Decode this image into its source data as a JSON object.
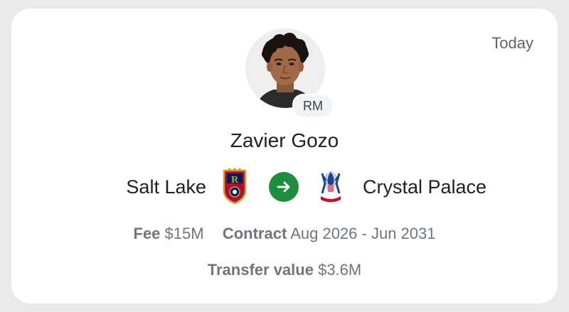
{
  "card": {
    "date": "Today",
    "player": {
      "name": "Zavier Gozo",
      "position": "RM"
    },
    "transfer": {
      "from_club": "Salt Lake",
      "to_club": "Crystal Palace",
      "arrow_icon": "arrow-right-icon",
      "arrow_color": "#1e8e3e"
    },
    "fee": {
      "label": "Fee",
      "value": "$15M"
    },
    "contract": {
      "label": "Contract",
      "value": "Aug 2026 - Jun 2031"
    },
    "transfer_value": {
      "label": "Transfer value",
      "value": "$3.6M"
    }
  }
}
